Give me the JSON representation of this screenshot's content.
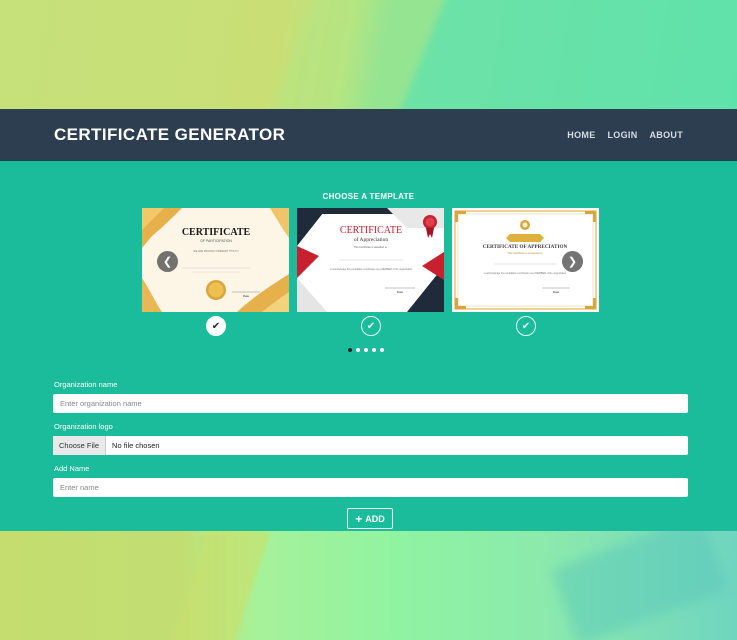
{
  "header": {
    "brand": "CERTIFICATE GENERATOR",
    "nav": [
      "HOME",
      "LOGIN",
      "ABOUT"
    ]
  },
  "templates": {
    "title": "CHOOSE A TEMPLATE",
    "selected_index": 0,
    "dots_count": 5,
    "active_dot": 0,
    "cards": [
      {
        "heading": "CERTIFICATE",
        "sub": "OF PARTICIPATION",
        "line": "WE ARE PROUDLY PRESENT THIS TO",
        "sign": "Date"
      },
      {
        "heading": "CERTIFICATE",
        "sub": "of Appreciation",
        "line": "This Certificate is awarded to :",
        "body": "in acknowledge his remarkable contribution as a MEMBER of the organization",
        "sign": "Date"
      },
      {
        "heading": "CERTIFICATE OF APPRECIATION",
        "sub": "This Certificate is presented to",
        "body": "in acknowledge his remarkable contribution as a MEMBER of the organization",
        "sign": "Date"
      }
    ],
    "colors": {
      "gold": "#d9a63c",
      "red": "#c8202f",
      "navy": "#1f2a3a"
    }
  },
  "form": {
    "org_name_label": "Organization name",
    "org_name_placeholder": "Enter organization name",
    "org_logo_label": "Organization logo",
    "file_button": "Choose File",
    "file_status": "No file chosen",
    "add_name_label": "Add Name",
    "add_name_placeholder": "Enter name",
    "add_button": "ADD"
  },
  "theme": {
    "navbar": "#2d3e50",
    "main": "#1abc9c"
  }
}
